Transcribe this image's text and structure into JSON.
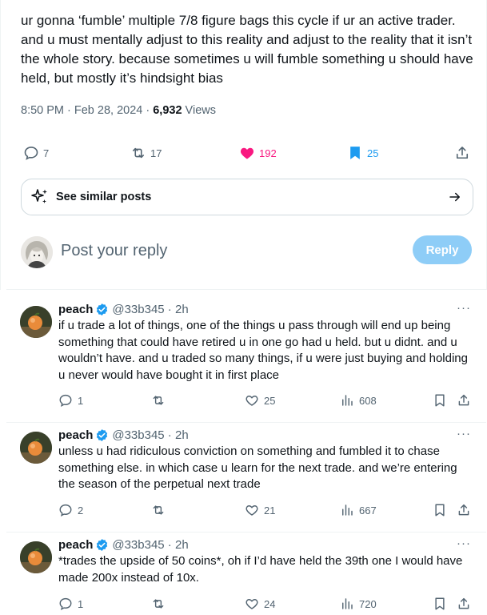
{
  "tweet": {
    "text": "ur gonna ‘fumble’ multiple 7/8 figure bags this cycle if ur an active trader. and u must mentally adjust to this reality and adjust to the reality that it isn’t the whole story. because sometimes u will fumble something u should have held, but mostly it’s hindsight bias",
    "time": "8:50 PM · Feb 28, 2024 · ",
    "views_count": "6,932",
    "views_label": " Views",
    "replies": "7",
    "reposts": "17",
    "likes": "192",
    "bookmarks": "25"
  },
  "similar": {
    "label": "See similar posts"
  },
  "compose": {
    "placeholder": "Post your reply",
    "button": "Reply"
  },
  "colors": {
    "like_active": "#f91880",
    "bookmark_active": "#1d9bf0",
    "verified": "#1d9bf0",
    "reply_button": "#8ecdf7"
  },
  "replies": [
    {
      "name": "peach",
      "handle": "@33b345 · 2h",
      "text": "if u trade a lot of things, one of the things u pass through will end up being something that could have retired u in one go had u held. but u didnt. and u wouldn’t have. and u traded so many things, if u were just buying and holding u never would have bought it in first place",
      "replies": "1",
      "likes": "25",
      "views": "608"
    },
    {
      "name": "peach",
      "handle": "@33b345 · 2h",
      "text": "unless u had ridiculous conviction on something and fumbled it to chase something else. in which case u learn for the next trade. and we’re entering the season of the perpetual next trade",
      "replies": "2",
      "likes": "21",
      "views": "667"
    },
    {
      "name": "peach",
      "handle": "@33b345 · 2h",
      "text": "*trades the upside of 50 coins*, oh if I’d have held the 39th one I would have made 200x instead of 10x.",
      "replies": "1",
      "likes": "24",
      "views": "720"
    }
  ]
}
